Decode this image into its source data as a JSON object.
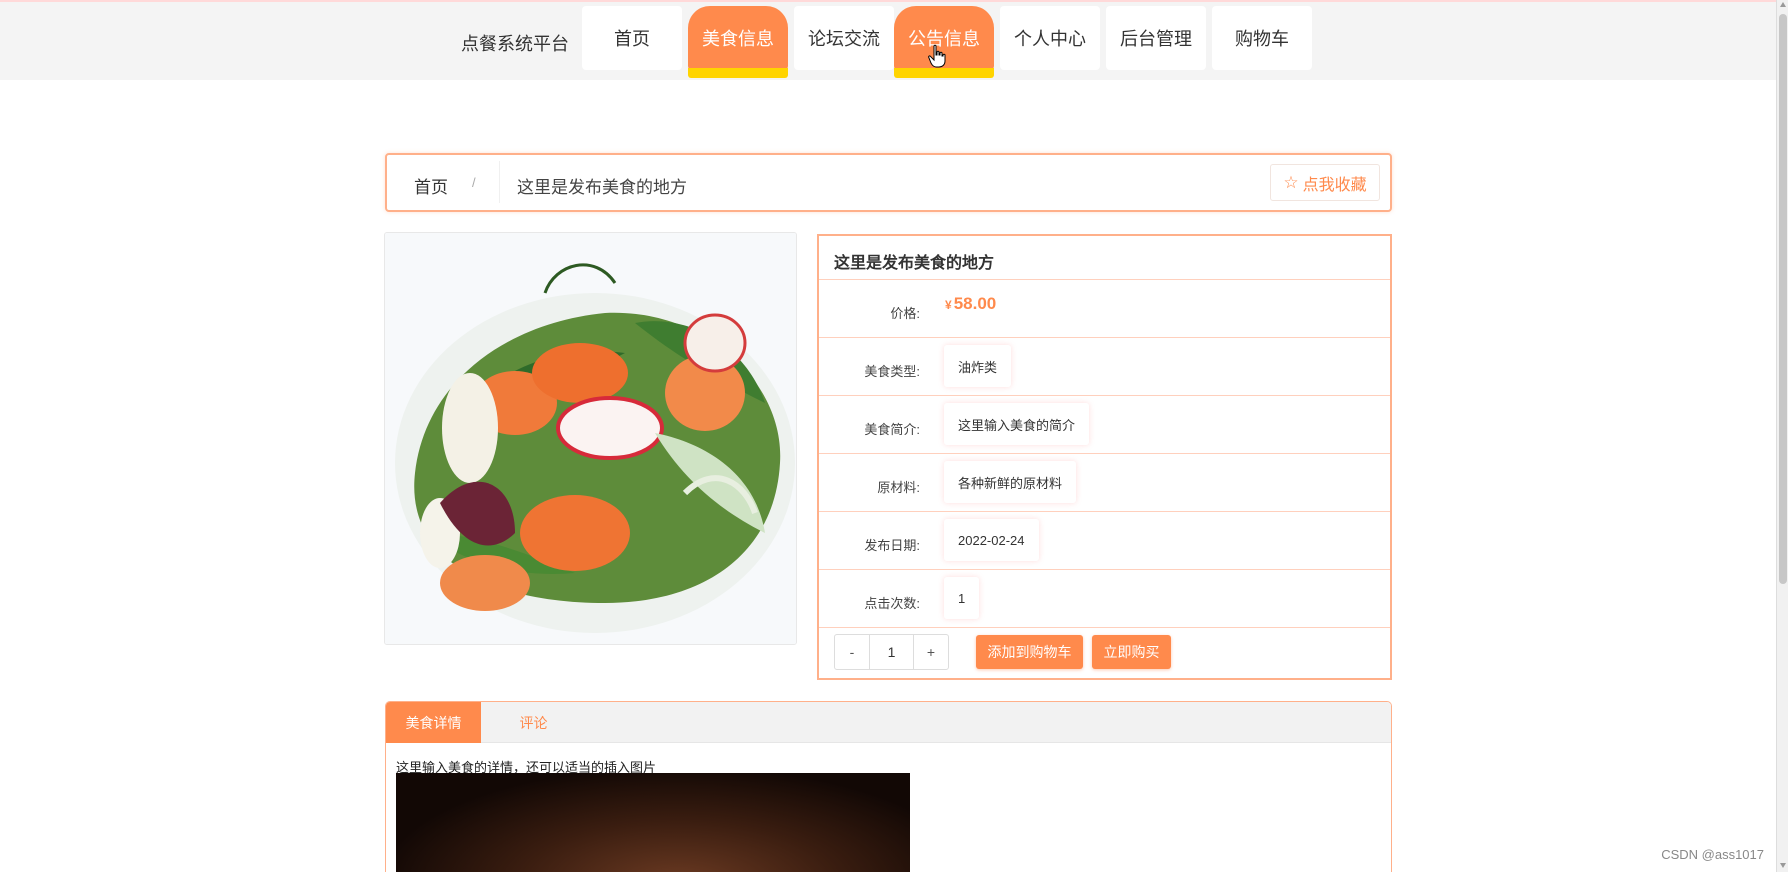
{
  "header": {
    "brand": "点餐系统平台",
    "nav": [
      {
        "label": "首页",
        "active": false
      },
      {
        "label": "美食信息",
        "active": true
      },
      {
        "label": "论坛交流",
        "active": false
      },
      {
        "label": "公告信息",
        "active": true
      },
      {
        "label": "个人中心",
        "active": false
      },
      {
        "label": "后台管理",
        "active": false
      },
      {
        "label": "购物车",
        "active": false
      }
    ]
  },
  "breadcrumb": {
    "home": "首页",
    "separator": "/",
    "current": "这里是发布美食的地方",
    "favorite_label": "点我收藏",
    "favorite_icon": "star-outline-icon"
  },
  "product": {
    "title": "这里是发布美食的地方",
    "price_label": "价格:",
    "currency": "¥",
    "price": "58.00",
    "fields": [
      {
        "label": "美食类型:",
        "value": "油炸类"
      },
      {
        "label": "美食简介:",
        "value": "这里输入美食的简介"
      },
      {
        "label": "原材料:",
        "value": "各种新鲜的原材料"
      },
      {
        "label": "发布日期:",
        "value": "2022-02-24"
      },
      {
        "label": "点击次数:",
        "value": "1"
      }
    ],
    "quantity": {
      "minus": "-",
      "value": "1",
      "plus": "+"
    },
    "add_to_cart": "添加到购物车",
    "buy_now": "立即购买"
  },
  "tabs": {
    "items": [
      "美食详情",
      "评论"
    ],
    "active_index": 0,
    "content_text": "这里输入美食的详情，还可以适当的插入图片"
  },
  "watermark": "CSDN @ass1017",
  "colors": {
    "accent": "#ff8a4c",
    "nav_highlight": "#ffd400",
    "border": "#ffb08a"
  }
}
